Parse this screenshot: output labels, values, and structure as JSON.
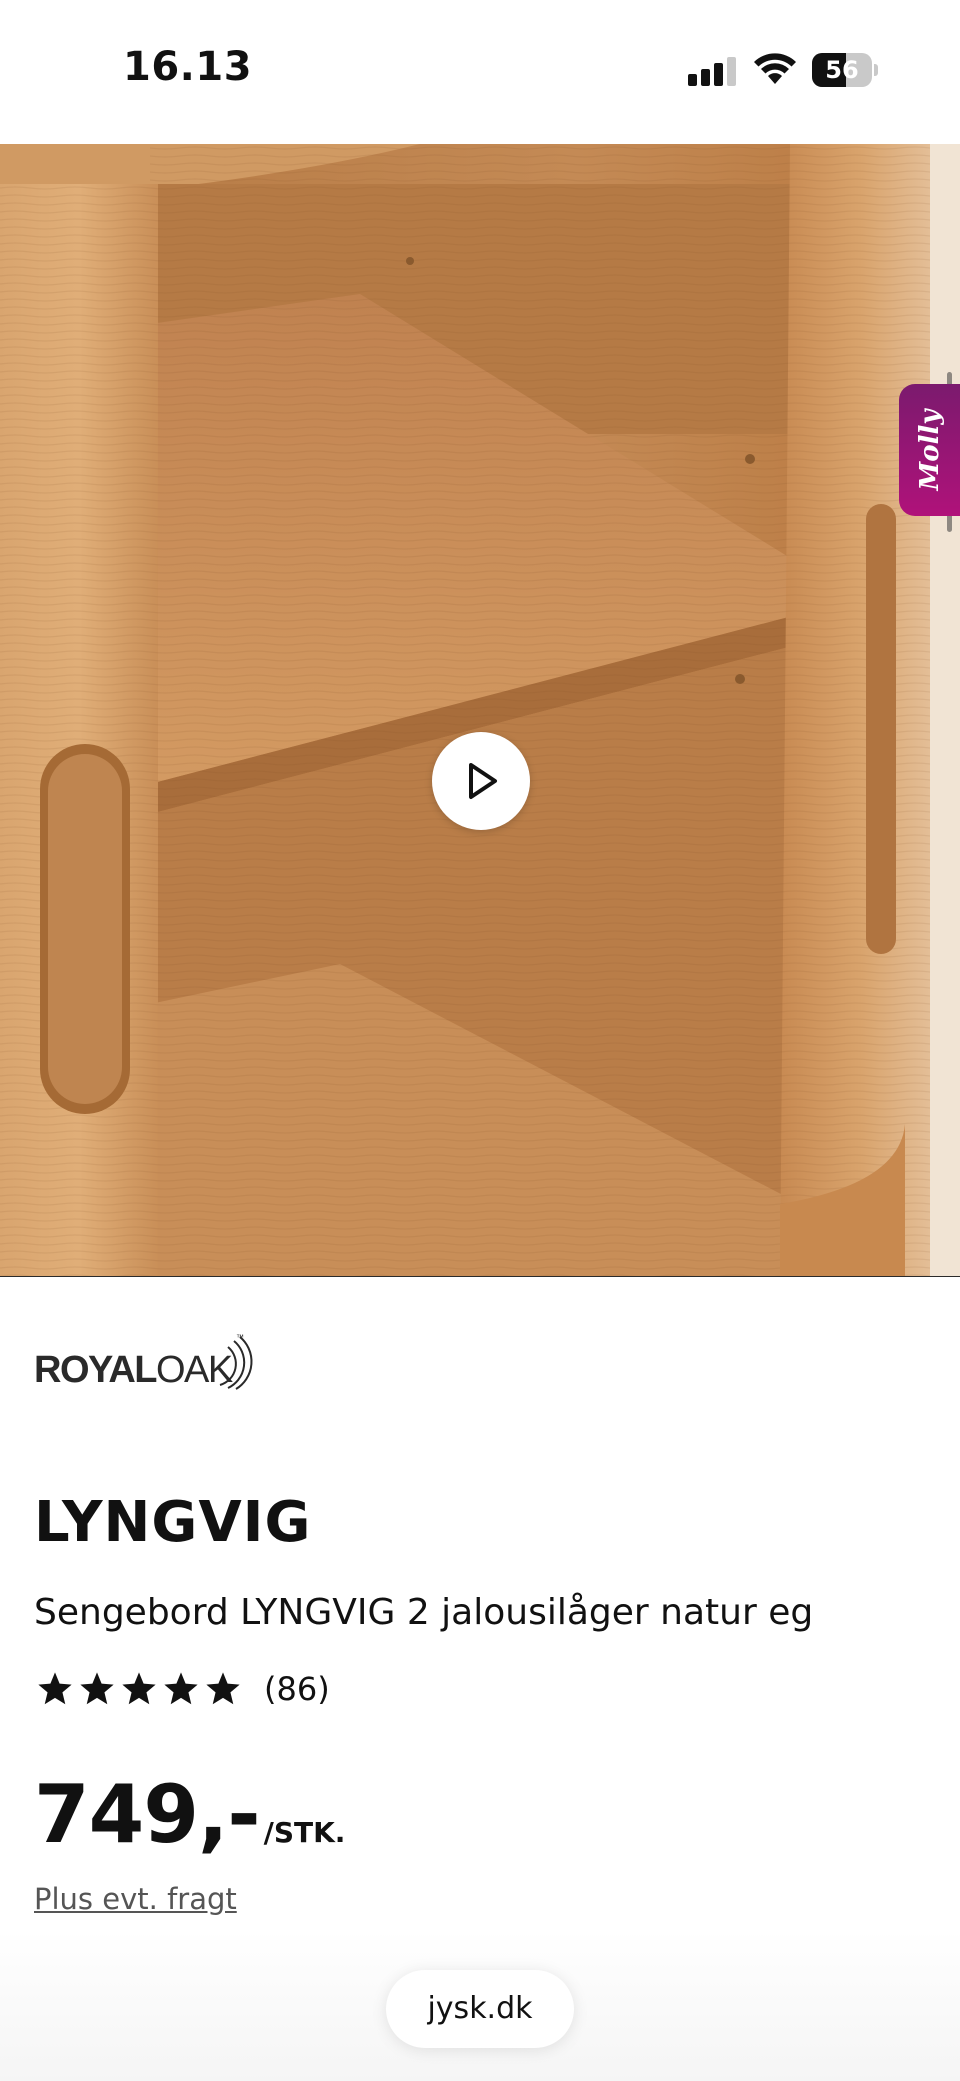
{
  "status_bar": {
    "time": "16.13",
    "battery_percent": "56",
    "battery_level": 0.56,
    "icons": [
      "cellular-signal-icon",
      "wifi-icon",
      "battery-icon"
    ]
  },
  "hero": {
    "image_description_icon": "bedside-table-photo",
    "play_icon": "play-icon",
    "carousel": {
      "total": 5,
      "active_index": 2
    },
    "chat_tab_label": "Molly"
  },
  "brand": {
    "royal": "ROYAL",
    "oak": "OAK",
    "tm": "™"
  },
  "product": {
    "title": "LYNGVIG",
    "subtitle": "Sengebord LYNGVIG 2 jalousilåger natur eg",
    "rating_stars": 5,
    "rating_count": "(86)",
    "price": "749,-",
    "price_unit": "/STK.",
    "freight_text": "Plus evt. fragt"
  },
  "browser": {
    "url": "jysk.dk"
  },
  "colors": {
    "wood": "#c48a55",
    "chat_tab": "#9b1474",
    "text": "#111111"
  }
}
